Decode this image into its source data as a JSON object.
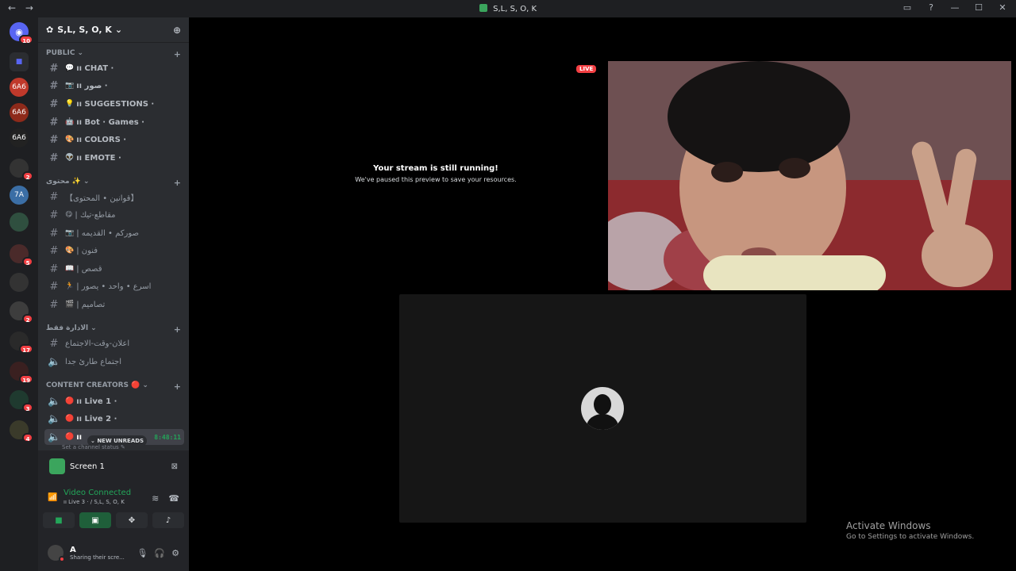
{
  "window": {
    "title": "S,L, S, O, K"
  },
  "guilds": [
    {
      "label": "",
      "badge": "10"
    },
    {
      "label": "",
      "badge": ""
    },
    {
      "label": "6A6",
      "badge": ""
    },
    {
      "label": "6A6",
      "badge": ""
    },
    {
      "label": "6A6",
      "badge": ""
    },
    {
      "label": "",
      "badge": "2"
    },
    {
      "label": "7A",
      "badge": ""
    },
    {
      "label": "",
      "badge": ""
    },
    {
      "label": "",
      "badge": "5"
    },
    {
      "label": "",
      "badge": ""
    },
    {
      "label": "",
      "badge": "2"
    },
    {
      "label": "",
      "badge": "17"
    },
    {
      "label": "",
      "badge": "19"
    },
    {
      "label": "",
      "badge": "3"
    },
    {
      "label": "",
      "badge": "4"
    }
  ],
  "server": {
    "name": "S,L, S, O, K"
  },
  "categories": [
    {
      "name": "PUBLIC"
    },
    {
      "name": "محتوى ✨"
    },
    {
      "name": "الادارة فقط"
    },
    {
      "name": "CONTENT CREATORS 🔴"
    }
  ],
  "channels": {
    "public": [
      {
        "emoji": "💬",
        "name": "ıı CHAT ·"
      },
      {
        "emoji": "📷",
        "name": "ıı صور ·"
      },
      {
        "emoji": "💡",
        "name": "ıı SUGGESTIONS ·"
      },
      {
        "emoji": "🤖",
        "name": "ıı Bot · Games ·"
      },
      {
        "emoji": "🎨",
        "name": "ıı COLORS ·"
      },
      {
        "emoji": "👽",
        "name": "ıı EMOTE ·"
      }
    ],
    "content": [
      {
        "emoji": "",
        "name": "【قوانين • المحتوى】"
      },
      {
        "emoji": "😋",
        "name": "| مقاطع-تيك"
      },
      {
        "emoji": "📷",
        "name": "| صوركم • القديمه"
      },
      {
        "emoji": "🎨",
        "name": "| فنون"
      },
      {
        "emoji": "📖",
        "name": "| قصص"
      },
      {
        "emoji": "🏃",
        "name": "| اسرع • واحد • يصور"
      },
      {
        "emoji": "🎬",
        "name": "| تصاميم"
      }
    ],
    "admin": [
      {
        "name": "اعلان-وقت-الاجتماع"
      },
      {
        "name": "اجتماع طارئ جدا"
      }
    ],
    "creators": [
      {
        "name": "ıı Live 1 ·"
      },
      {
        "name": "ıı Live 2 ·"
      },
      {
        "name": "ıı"
      }
    ]
  },
  "active_timer": "8:48:11",
  "new_unreads": "NEW UNREADS",
  "channel_status": "Set a channel status",
  "panel": {
    "screen_label": "Screen 1",
    "connection": "Video Connected",
    "connection_detail": "ıı Live 3 · / S,L, S, O, K"
  },
  "user": {
    "name": "A",
    "status": "Sharing their scre..."
  },
  "stream": {
    "live_badge": "LIVE",
    "paused_title": "Your stream is still running!",
    "paused_subtitle": "We've paused this preview to save your resources."
  },
  "watermark": {
    "title": "Activate Windows",
    "subtitle": "Go to Settings to activate Windows."
  }
}
